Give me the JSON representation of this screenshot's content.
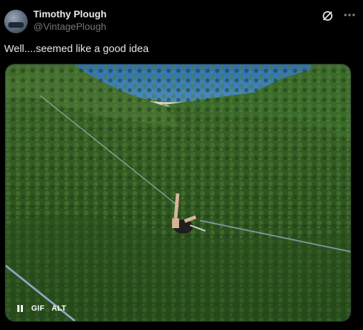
{
  "post": {
    "author": {
      "display_name": "Timothy Plough",
      "handle": "@VintagePlough"
    },
    "text": "Well....seemed like a good idea",
    "media": {
      "gif_label": "GIF",
      "alt_label": "ALT"
    }
  }
}
